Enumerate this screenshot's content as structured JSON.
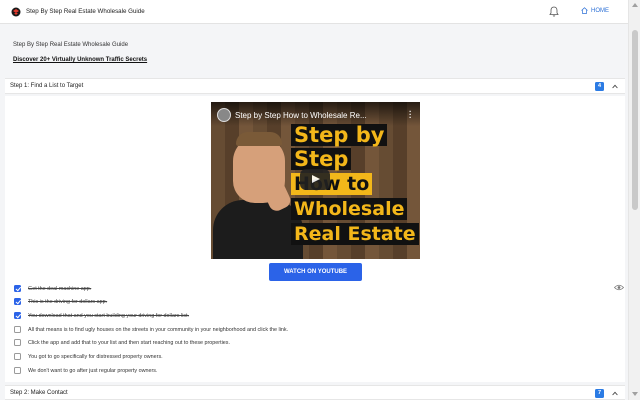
{
  "topbar": {
    "app_title": "Step By Step Real Estate Wholesale Guide",
    "home_label": "HOME",
    "logo_icon": "logo-icon",
    "bell_icon": "bell-icon",
    "home_icon": "home-icon"
  },
  "intro": {
    "title": "Step By Step Real Estate Wholesale Guide",
    "link": "Discover 20+ Virtually Unknown Traffic Secrets"
  },
  "steps": [
    {
      "label": "Step 1: Find a List to Target",
      "badge": "4"
    },
    {
      "label": "Step 2: Make Contact",
      "badge": "7"
    }
  ],
  "video": {
    "title": "Step by Step How to Wholesale Re...",
    "headline": [
      "Step by",
      "Step",
      "How to",
      "Wholesale",
      "Real Estate"
    ],
    "button": "WATCH ON YOUTUBE"
  },
  "tasks": [
    {
      "text": "Get the deal machine app.",
      "checked": true
    },
    {
      "text": "This is the driving for dollars app.",
      "checked": true
    },
    {
      "text": "You download that and you start building your driving for dollars list.",
      "checked": true
    },
    {
      "text": "All that means is to find ugly houses on the streets in your community in your neighborhood and click the link.",
      "checked": false
    },
    {
      "text": "Click the app and add that to your list and then start reaching out to these properties.",
      "checked": false
    },
    {
      "text": "You got to go specifically for distressed property owners.",
      "checked": false
    },
    {
      "text": "We don't want to go after just regular property owners.",
      "checked": false
    }
  ],
  "colors": {
    "accent": "#2b63e8",
    "badge": "#2b7be4",
    "headline_yellow": "#f3b71a"
  }
}
